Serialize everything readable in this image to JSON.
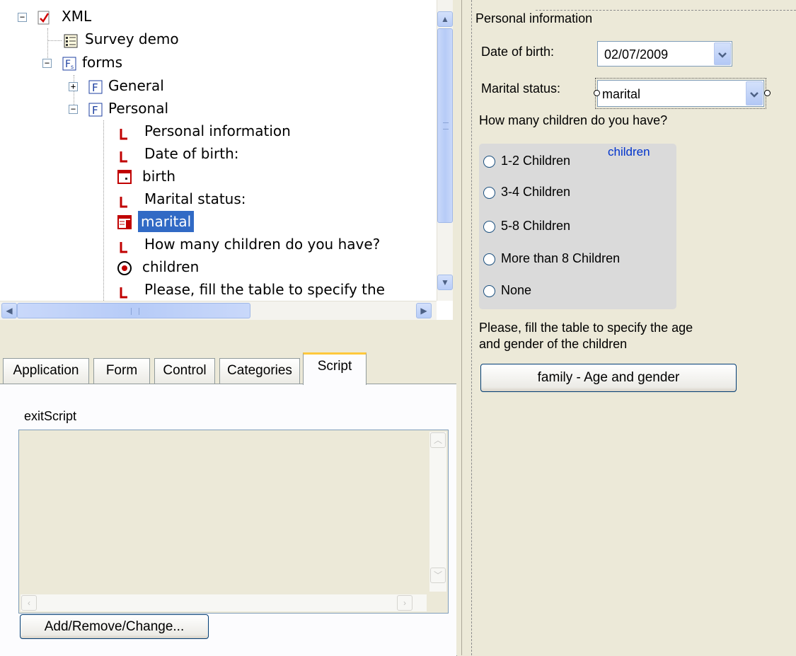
{
  "tree": {
    "items": [
      {
        "label": "XML"
      },
      {
        "label": "Survey demo"
      },
      {
        "label": "forms"
      },
      {
        "label": "General"
      },
      {
        "label": "Personal"
      },
      {
        "label": "Personal information"
      },
      {
        "label": "Date of birth:"
      },
      {
        "label": "birth"
      },
      {
        "label": "Marital status:"
      },
      {
        "label": "marital"
      },
      {
        "label": "How many children do you have?"
      },
      {
        "label": "children"
      },
      {
        "label": "Please, fill the table to specify the"
      }
    ],
    "selected": "marital"
  },
  "tabs": [
    {
      "label": "Application"
    },
    {
      "label": "Form"
    },
    {
      "label": "Control"
    },
    {
      "label": "Categories"
    },
    {
      "label": "Script"
    }
  ],
  "script_panel": {
    "event_label": "exitScript",
    "script_text": "",
    "add_button": "Add/Remove/Change..."
  },
  "form": {
    "title": "Personal information",
    "dob_label": "Date of birth:",
    "dob_value": "02/07/2009",
    "marital_label": "Marital status:",
    "marital_value": "marital",
    "children_question": "How many children do you have?",
    "children_group": "children",
    "options": [
      "1-2 Children",
      "3-4 Children",
      "5-8 Children",
      "More than 8 Children",
      "None"
    ],
    "table_prompt_1": "Please, fill the table to specify the age",
    "table_prompt_2": "and gender of the children",
    "table_button": "family - Age and gender"
  },
  "colors": {
    "selection": "#316ac5",
    "active_tab": "#ffc83c",
    "label_icon": "#c00000",
    "group_label": "#0033cc"
  }
}
